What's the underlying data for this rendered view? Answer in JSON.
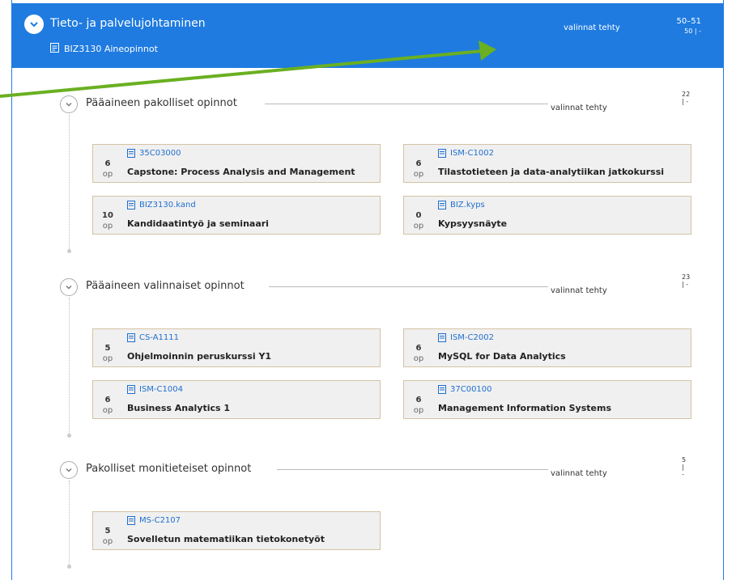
{
  "header": {
    "title": "Tieto- ja palvelujohtaminen",
    "subtitle": "BIZ3130 Aineopinnot",
    "status": "valinnat tehty",
    "credits_main": "50–51",
    "credits_sub": "50 | -"
  },
  "sections": [
    {
      "title": "Pääaineen pakolliset opinnot",
      "status": "valinnat tehty",
      "credits": "22 | -",
      "courses": [
        {
          "credits": "6",
          "unit": "op",
          "code": "35C03000",
          "name": "Capstone: Process Analysis and Management"
        },
        {
          "credits": "6",
          "unit": "op",
          "code": "ISM-C1002",
          "name": "Tilastotieteen ja data-analytiikan jatkokurssi"
        },
        {
          "credits": "10",
          "unit": "op",
          "code": "BIZ3130.kand",
          "name": "Kandidaatintyö ja seminaari"
        },
        {
          "credits": "0",
          "unit": "op",
          "code": "BIZ.kyps",
          "name": "Kypsyysnäyte"
        }
      ]
    },
    {
      "title": "Pääaineen valinnaiset opinnot",
      "status": "valinnat tehty",
      "credits": "23 | -",
      "courses": [
        {
          "credits": "5",
          "unit": "op",
          "code": "CS-A1111",
          "name": "Ohjelmoinnin peruskurssi Y1"
        },
        {
          "credits": "6",
          "unit": "op",
          "code": "ISM-C2002",
          "name": "MySQL for Data Analytics"
        },
        {
          "credits": "6",
          "unit": "op",
          "code": "ISM-C1004",
          "name": "Business Analytics 1"
        },
        {
          "credits": "6",
          "unit": "op",
          "code": "37C00100",
          "name": "Management Information Systems"
        }
      ]
    },
    {
      "title": "Pakolliset monitieteiset opinnot",
      "status": "valinnat tehty",
      "credits": "5 | -",
      "courses": [
        {
          "credits": "5",
          "unit": "op",
          "code": "MS-C2107",
          "name": "Sovelletun matematiikan tietokonetyöt"
        }
      ]
    }
  ],
  "colors": {
    "header_bg": "#1f7be0",
    "arrow": "#6ab021",
    "link": "#1f6fd0",
    "card_border": "#d4c3a3"
  },
  "icons": {
    "toggle": "chevron-down-icon",
    "course": "document-icon"
  }
}
